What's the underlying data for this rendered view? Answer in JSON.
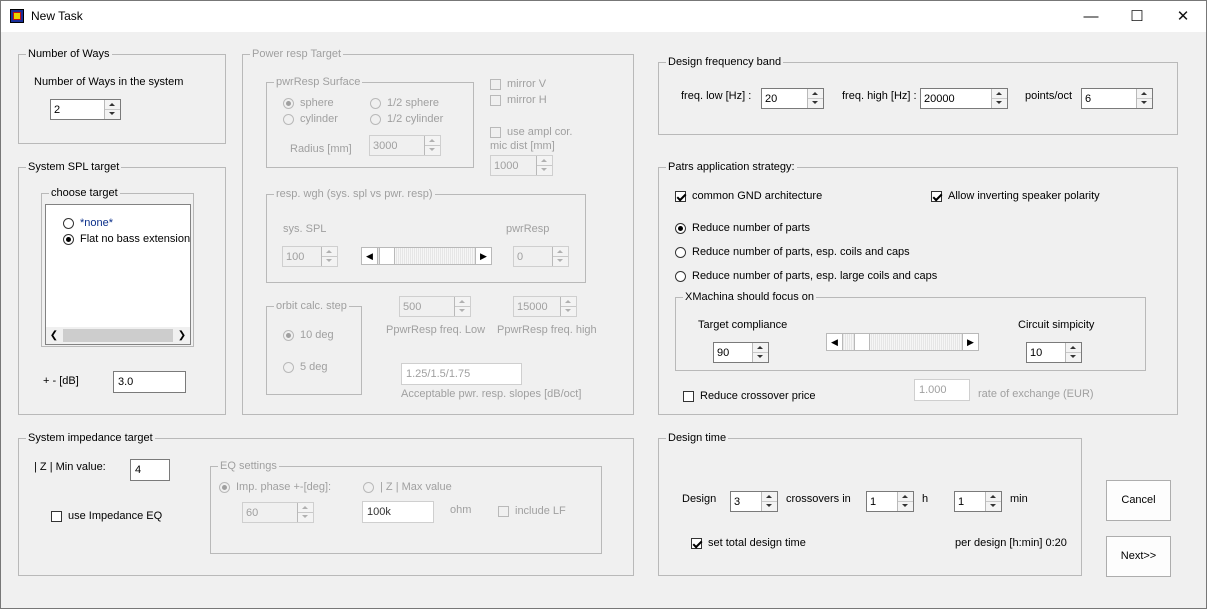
{
  "window": {
    "title": "New Task",
    "controls": {
      "minimize": "—",
      "maximize": "☐",
      "close": "✕"
    }
  },
  "ways": {
    "legend": "Number of Ways",
    "label": "Number of Ways in the system",
    "value": "2"
  },
  "spl": {
    "legend": "System SPL target",
    "choose_legend": "choose target",
    "options": [
      {
        "label": "*none*",
        "selected": false
      },
      {
        "label": "Flat no bass extension",
        "selected": true
      }
    ],
    "tol_label": "+ - [dB]",
    "tol_value": "3.0"
  },
  "power": {
    "legend": "Power resp Target",
    "surface_legend": "pwrResp Surface",
    "sphere": "sphere",
    "half_sphere": "1/2 sphere",
    "cylinder": "cylinder",
    "half_cylinder": "1/2 cylinder",
    "radius_label": "Radius [mm]",
    "radius_value": "3000",
    "mirror_v": "mirror V",
    "mirror_h": "mirror H",
    "use_ampl": "use ampl cor.",
    "mic_dist_label": "mic dist [mm]",
    "mic_dist_value": "1000",
    "wgh_legend": "resp. wgh  (sys. spl vs pwr. resp)",
    "sys_spl_label": "sys. SPL",
    "pwrresp_label": "pwrResp",
    "sys_spl_value": "100",
    "pwrresp_value": "0",
    "orbit_legend": "orbit calc. step",
    "deg10": "10 deg",
    "deg5": "5 deg",
    "freq_low_value": "500",
    "freq_high_value": "15000",
    "freq_low_label": "PpwrResp  freq. Low",
    "freq_high_label": "PpwrResp  freq. high",
    "slopes_value": "1.25/1.5/1.75",
    "slopes_label": "Acceptable pwr. resp. slopes [dB/oct]"
  },
  "band": {
    "legend": "Design frequency band",
    "low_label": "freq. low [Hz] :",
    "low_value": "20",
    "high_label": "freq. high [Hz] :",
    "high_value": "20000",
    "ppo_label": "points/oct",
    "ppo_value": "6"
  },
  "strategy": {
    "legend": "Patrs application strategy:",
    "common_gnd": "common GND architecture",
    "allow_invert": "Allow inverting speaker polarity",
    "reduce_parts": "Reduce number of parts",
    "reduce_coils_caps": "Reduce number of parts, esp. coils and caps",
    "reduce_large": "Reduce number of parts, esp. large coils and caps",
    "focus_legend": "XMachina should focus on",
    "target_compliance": "Target compliance",
    "circuit_simplicity": "Circuit simpicity",
    "compliance_value": "90",
    "simplicity_value": "10",
    "reduce_price": "Reduce crossover price",
    "exchange_value": "1.000",
    "exchange_label": "rate of exchange (EUR)"
  },
  "impedance": {
    "legend": "System impedance target",
    "min_label": "| Z | Min value:",
    "min_value": "4",
    "use_eq": "use Impedance EQ",
    "eq_legend": "EQ settings",
    "imp_phase": "Imp. phase +-[deg]:",
    "imp_phase_value": "60",
    "z_max": "| Z | Max value",
    "z_max_value": "100k",
    "ohm": "ohm",
    "include_lf": "include LF"
  },
  "design_time": {
    "legend": "Design time",
    "design_label": "Design",
    "count": "3",
    "crossovers_in": "crossovers in",
    "hours": "1",
    "h": "h",
    "minutes": "1",
    "min": "min",
    "set_total": "set total design time",
    "per_design": "per design [h:min] 0:20"
  },
  "buttons": {
    "cancel": "Cancel",
    "next": "Next>>"
  }
}
